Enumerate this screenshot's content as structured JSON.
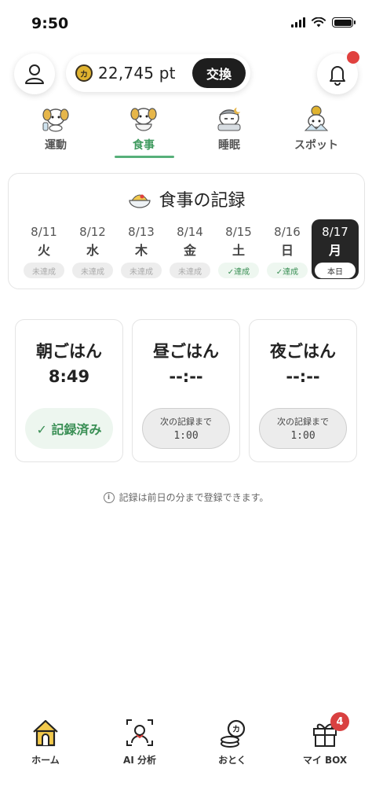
{
  "status_bar": {
    "time": "9:50"
  },
  "header": {
    "points_value": "22,745 pt",
    "coin_symbol": "カ",
    "exchange_label": "交換",
    "notification_dot": true
  },
  "tabs": [
    {
      "label": "運動",
      "icon": "dog-exercise-icon",
      "active": false
    },
    {
      "label": "食事",
      "icon": "dog-meal-icon",
      "active": true
    },
    {
      "label": "睡眠",
      "icon": "dog-sleep-icon",
      "active": false
    },
    {
      "label": "スポット",
      "icon": "dog-spot-icon",
      "active": false
    }
  ],
  "record": {
    "title": "食事の記録",
    "days": [
      {
        "date": "8/11",
        "weekday": "火",
        "status": "未達成"
      },
      {
        "date": "8/12",
        "weekday": "水",
        "status": "未達成"
      },
      {
        "date": "8/13",
        "weekday": "木",
        "status": "未達成"
      },
      {
        "date": "8/14",
        "weekday": "金",
        "status": "未達成"
      },
      {
        "date": "8/15",
        "weekday": "土",
        "status": "✓達成"
      },
      {
        "date": "8/16",
        "weekday": "日",
        "status": "✓達成"
      },
      {
        "date": "8/17",
        "weekday": "月",
        "status": "本日"
      }
    ]
  },
  "meals": [
    {
      "name": "朝ごはん",
      "time": "8:49",
      "button": "✓ 記録済み",
      "state": "done"
    },
    {
      "name": "昼ごはん",
      "time": "--:--",
      "button_label": "次の記録まで",
      "button_time": "1:00",
      "state": "wait"
    },
    {
      "name": "夜ごはん",
      "time": "--:--",
      "button_label": "次の記録まで",
      "button_time": "1:00",
      "state": "wait"
    }
  ],
  "note": "記録は前日の分まで登録できます。",
  "bottom_nav": [
    {
      "label": "ホーム",
      "icon": "home-icon"
    },
    {
      "label": "AI 分析",
      "icon": "ai-scan-icon"
    },
    {
      "label": "おとく",
      "icon": "coins-icon"
    },
    {
      "label": "マイ BOX",
      "icon": "gift-icon",
      "badge": "4"
    }
  ],
  "colors": {
    "accent_green": "#57b07a",
    "badge_red": "#d94040",
    "dark": "#262626"
  }
}
